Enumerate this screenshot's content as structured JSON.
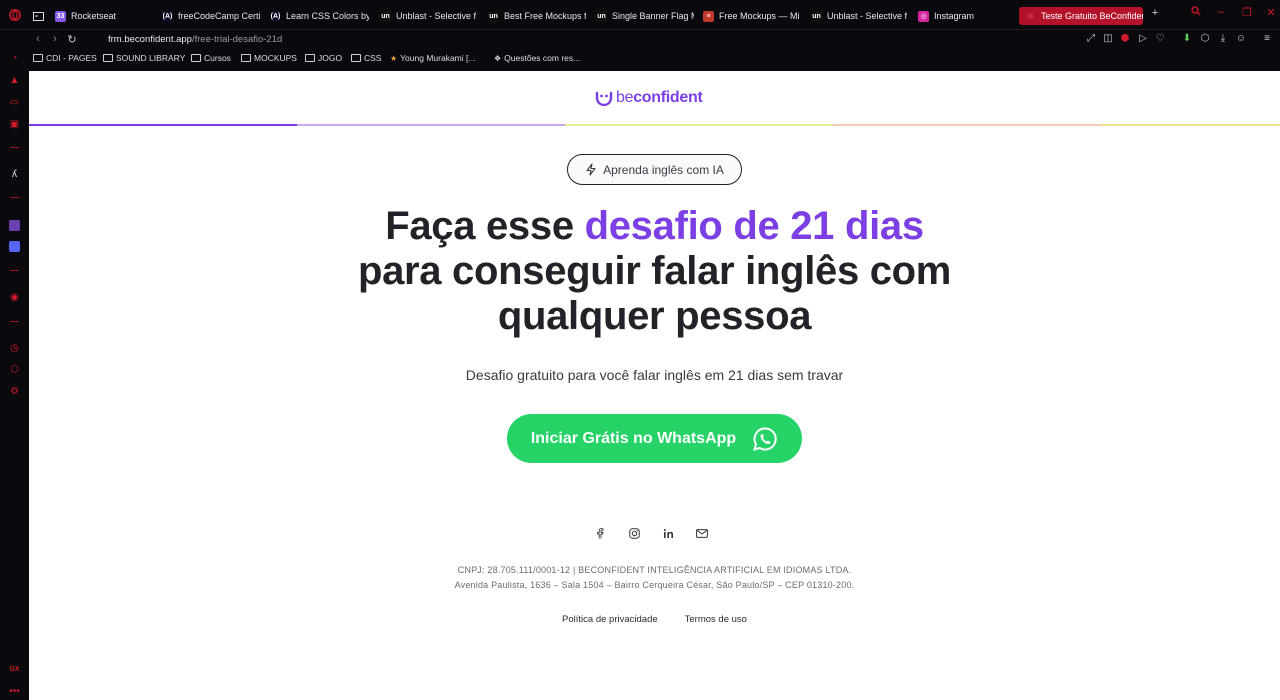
{
  "browser": {
    "tabs": [
      {
        "label": "Rocketseat",
        "favicon_text": "33",
        "favicon_color": "#8257e5"
      },
      {
        "label": "freeCodeCamp Certi",
        "favicon_text": "(A)",
        "favicon_color": "#0a0a23"
      },
      {
        "label": "Learn CSS Colors by",
        "favicon_text": "(A)",
        "favicon_color": "#0a0a23"
      },
      {
        "label": "Unblast - Selective f",
        "favicon_text": "un",
        "favicon_color": "#111111"
      },
      {
        "label": "Best Free Mockups f",
        "favicon_text": "un",
        "favicon_color": "#111111"
      },
      {
        "label": "Single Banner Flag M",
        "favicon_text": "un",
        "favicon_color": "#111111"
      },
      {
        "label": "Free Mockups — Mi",
        "favicon_text": "≡",
        "favicon_color": "#c0392b"
      },
      {
        "label": "Unblast - Selective f",
        "favicon_text": "un",
        "favicon_color": "#111111"
      },
      {
        "label": "Instagram",
        "favicon_text": "◎",
        "favicon_color": "#d6249f"
      }
    ],
    "active_tab": {
      "label": "Teste Gratuito BeConfiden"
    },
    "url_host": "frm.beconfident.app",
    "url_path": "/free-trial-desafio-21d",
    "bookmarks": [
      {
        "label": "CDI - PAGES",
        "type": "folder"
      },
      {
        "label": "SOUND LIBRARY",
        "type": "folder"
      },
      {
        "label": "Cursos",
        "type": "folder"
      },
      {
        "label": "MOCKUPS",
        "type": "folder"
      },
      {
        "label": "JOGO",
        "type": "folder"
      },
      {
        "label": "CSS",
        "type": "folder"
      },
      {
        "label": "Young Murakami [...",
        "type": "link"
      },
      {
        "label": "Questões com res...",
        "type": "link"
      }
    ]
  },
  "page": {
    "logo_prefix": "be",
    "logo_suffix": "confident",
    "badge": "Aprenda inglês com IA",
    "headline_part1": "Faça esse ",
    "headline_highlight": "desafio de 21 dias",
    "headline_part2": "para conseguir falar inglês com qualquer pessoa",
    "subtitle": "Desafio gratuito para você falar inglês em 21 dias sem travar",
    "cta_label": "Iniciar Grátis no WhatsApp",
    "legal_line1": "CNPJ: 28.705.111/0001-12 | BECONFIDENT INTELIGÊNCIA ARTIFICIAL EM IDIOMAS LTDA.",
    "legal_line2": "Avenida Paulista, 1636 – Sala 1504 – Bairro Cerqueira César, São Paulo/SP – CEP 01310-200.",
    "privacy_link": "Política de privacidade",
    "terms_link": "Termos de uso",
    "colors": {
      "brand_purple": "#7b3fe4",
      "whatsapp_green": "#25d366",
      "opera_red": "#d11a2a"
    },
    "progress_colors": [
      "#7b3fe4",
      "#c7a6f2",
      "#e8ec9c",
      "#f6c9b8",
      "#efe488"
    ]
  }
}
